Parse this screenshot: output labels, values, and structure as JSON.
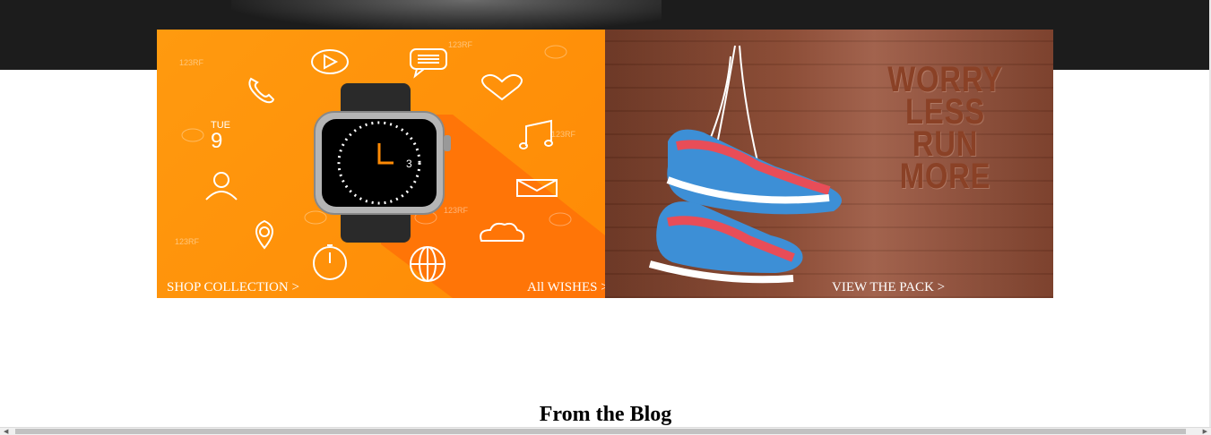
{
  "banners": {
    "watch": {
      "shop_label": "SHOP COLLECTION >",
      "wishes_label": "All WISHES >",
      "date_day": "TUE",
      "date_num": "9",
      "clock_num": "3",
      "watermark": "123RF"
    },
    "shoes": {
      "tagline": [
        "WORRY",
        "LESS",
        "RUN",
        "MORE"
      ],
      "cta_label": "VIEW THE PACK >"
    }
  },
  "blog": {
    "heading": "From the Blog"
  },
  "colors": {
    "accent_orange": "#ff8a05",
    "dark_band": "#1c1c1c",
    "wood": "#8a4a33"
  }
}
